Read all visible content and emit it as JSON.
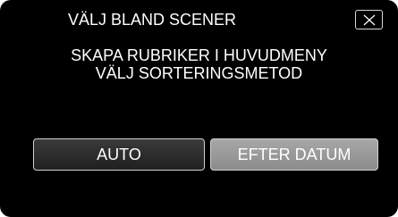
{
  "header": {
    "title": "VÄLJ BLAND SCENER",
    "close_icon": "close-icon"
  },
  "message": {
    "line1": "SKAPA RUBRIKER I HUVUDMENY",
    "line2": "VÄLJ SORTERINGSMETOD"
  },
  "options": {
    "auto_label": "AUTO",
    "date_label": "EFTER DATUM",
    "selected": "EFTER DATUM"
  },
  "colors": {
    "background": "#000000",
    "text": "#ffffff",
    "button_default": "#2c2c2c",
    "button_highlighted": "#999999"
  }
}
